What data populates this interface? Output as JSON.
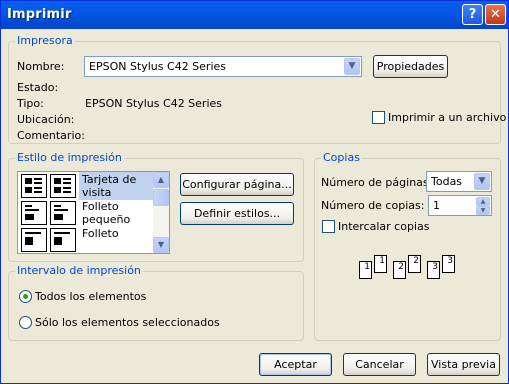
{
  "window": {
    "title": "Imprimir",
    "help_glyph": "?",
    "close_glyph": "✕"
  },
  "printer": {
    "group_label": "Impresora",
    "name_label": "Nombre:",
    "name_value": "EPSON Stylus C42 Series",
    "properties_label": "Propiedades",
    "status_label": "Estado:",
    "status_value": "",
    "type_label": "Tipo:",
    "type_value": "EPSON Stylus C42 Series",
    "location_label": "Ubicación:",
    "location_value": "",
    "comment_label": "Comentario:",
    "comment_value": "",
    "print_to_file_label": "Imprimir a un archivo",
    "print_to_file_checked": false
  },
  "print_style": {
    "group_label": "Estilo de impresión",
    "items": [
      {
        "name": "Tarjeta de visita",
        "selected": true
      },
      {
        "name": "Folleto pequeño",
        "selected": false
      },
      {
        "name": "Folleto",
        "selected": false
      }
    ],
    "configure_page_label": "Configurar página...",
    "define_styles_label": "Definir estilos..."
  },
  "copies": {
    "group_label": "Copias",
    "pages_label": "Número de páginas:",
    "pages_value": "Todas",
    "copies_label": "Número de copias:",
    "copies_value": "1",
    "collate_label": "Intercalar copias",
    "collate_checked": false,
    "collate_icons": [
      "1",
      "1",
      "2",
      "2",
      "3",
      "3"
    ]
  },
  "range": {
    "group_label": "Intervalo de impresión",
    "options": [
      {
        "label": "Todos los elementos",
        "selected": true
      },
      {
        "label": "Sólo los elementos seleccionados",
        "selected": false
      }
    ]
  },
  "footer": {
    "accept_label": "Aceptar",
    "cancel_label": "Cancelar",
    "preview_label": "Vista previa"
  },
  "colors": {
    "title_bar": "#0256e3",
    "group_label": "#0046d5",
    "window_bg": "#ece9d8"
  }
}
